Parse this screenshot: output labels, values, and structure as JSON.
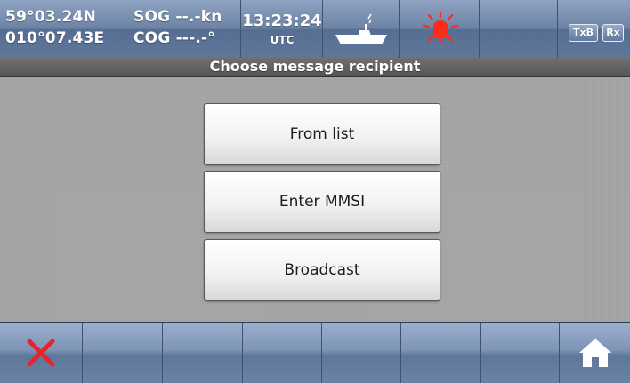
{
  "status": {
    "latitude": "59°03.24N",
    "longitude": "010°07.43E",
    "sog": "SOG --.-kn",
    "cog": "COG ---.-°",
    "time": "13:23:24",
    "time_zone": "UTC",
    "vessel_icon": "vessel-icon",
    "alarm_icon": "alarm-bell-icon",
    "alarm_color": "#ff2a1a",
    "tx_label": "TxB",
    "rx_label": "Rx"
  },
  "title": "Choose message recipient",
  "options": [
    {
      "label": "From list"
    },
    {
      "label": "Enter MMSI"
    },
    {
      "label": "Broadcast"
    }
  ],
  "bottom_bar": {
    "cancel_icon": "close-icon",
    "cancel_color": "#e8232a",
    "home_icon": "home-icon"
  }
}
